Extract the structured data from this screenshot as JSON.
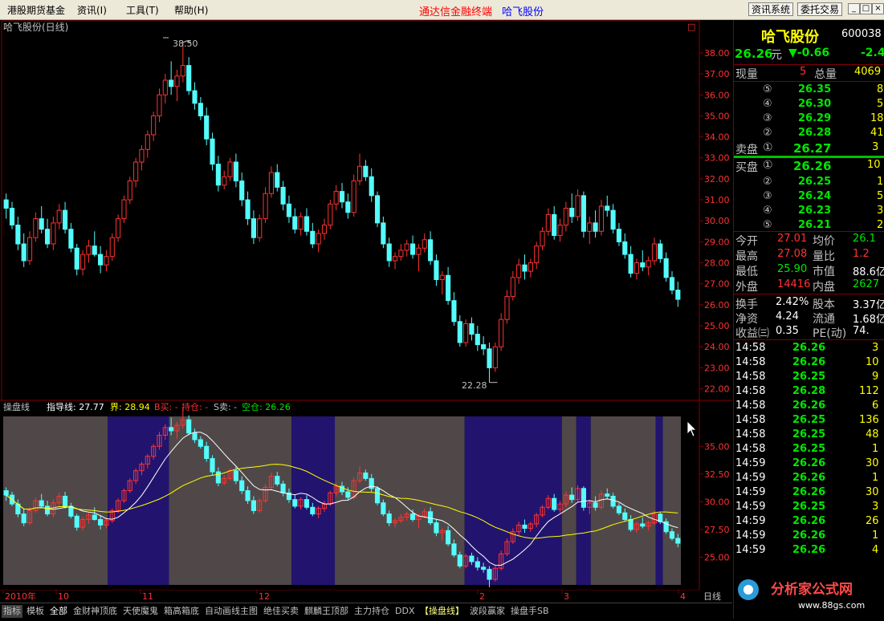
{
  "menu": {
    "items": [
      "港股期货基金",
      "资讯(I)",
      "工具(T)",
      "帮助(H)"
    ],
    "center_title": "通达信金融终端",
    "center_stock": "哈飞股份",
    "btn_news": "资讯系统",
    "btn_trade": "委托交易",
    "win_min": "_",
    "win_max": "□",
    "win_close": "×"
  },
  "colors": {
    "up": "#ff3232",
    "down": "#54fcfc",
    "green": "#00e600",
    "yellow": "#ffff00",
    "white": "#ffffff",
    "gray": "#c0c0c0"
  },
  "main_chart": {
    "title": "哈飞股份(日线)",
    "max_label": "38.50",
    "min_label": "22.28",
    "corner_box": "□"
  },
  "indicator_chart": {
    "name": "操盘线",
    "line_label": "指导线: 27.77",
    "bound_label": "界: 28.94",
    "b_buy": "B买: -",
    "hold": "持仓: -",
    "s_sell": "S卖: -",
    "empty": "空仓: 26.26"
  },
  "chart_data": {
    "type": "candlestick",
    "y_ticks": [
      "38.00",
      "37.00",
      "36.00",
      "35.00",
      "34.00",
      "33.00",
      "32.00",
      "31.00",
      "30.00",
      "29.00",
      "28.00",
      "27.00",
      "26.00",
      "25.00",
      "24.00",
      "23.00",
      "22.00"
    ],
    "y_range": [
      21.6,
      38.8
    ],
    "indicator_y_ticks": [
      "35.00",
      "32.50",
      "30.00",
      "27.50",
      "25.00"
    ],
    "indicator_y_range": [
      22.5,
      37.7
    ],
    "x_labels": [
      "2010年",
      "10",
      "11",
      "12",
      "2",
      "3",
      "4"
    ],
    "candles": [
      [
        31.0,
        31.3,
        30.1,
        30.6
      ],
      [
        30.6,
        30.9,
        29.6,
        29.8
      ],
      [
        29.8,
        30.2,
        28.6,
        28.9
      ],
      [
        28.9,
        29.4,
        27.8,
        28.1
      ],
      [
        28.1,
        29.5,
        27.9,
        29.2
      ],
      [
        29.2,
        30.4,
        29.0,
        30.1
      ],
      [
        30.1,
        30.7,
        29.4,
        29.6
      ],
      [
        29.6,
        30.1,
        28.7,
        28.9
      ],
      [
        28.9,
        30.2,
        28.6,
        29.9
      ],
      [
        29.9,
        30.8,
        29.6,
        30.5
      ],
      [
        30.5,
        30.9,
        29.4,
        29.6
      ],
      [
        29.6,
        29.9,
        28.5,
        28.7
      ],
      [
        28.7,
        28.9,
        27.4,
        27.7
      ],
      [
        27.7,
        28.6,
        27.4,
        28.4
      ],
      [
        28.4,
        29.1,
        28.0,
        28.8
      ],
      [
        28.8,
        29.5,
        28.3,
        28.4
      ],
      [
        28.4,
        28.8,
        27.5,
        27.9
      ],
      [
        27.9,
        28.6,
        27.6,
        28.3
      ],
      [
        28.3,
        29.4,
        28.1,
        29.2
      ],
      [
        29.2,
        30.3,
        29.0,
        30.1
      ],
      [
        30.1,
        31.2,
        29.9,
        31.0
      ],
      [
        31.0,
        32.1,
        30.8,
        31.9
      ],
      [
        31.9,
        33.0,
        31.6,
        32.8
      ],
      [
        32.8,
        33.6,
        32.4,
        33.4
      ],
      [
        33.4,
        34.3,
        33.0,
        34.1
      ],
      [
        34.1,
        35.2,
        33.8,
        35.0
      ],
      [
        35.0,
        36.3,
        34.7,
        36.0
      ],
      [
        36.0,
        37.0,
        35.6,
        36.7
      ],
      [
        36.7,
        37.6,
        36.0,
        36.4
      ],
      [
        36.4,
        37.2,
        35.7,
        36.9
      ],
      [
        36.9,
        38.5,
        36.6,
        37.4
      ],
      [
        37.4,
        37.8,
        36.0,
        36.2
      ],
      [
        36.2,
        36.6,
        35.3,
        35.6
      ],
      [
        35.6,
        35.9,
        34.8,
        35.0
      ],
      [
        35.0,
        35.4,
        33.6,
        33.9
      ],
      [
        33.9,
        34.2,
        32.4,
        32.7
      ],
      [
        32.7,
        33.1,
        31.4,
        31.7
      ],
      [
        31.7,
        32.4,
        31.5,
        32.1
      ],
      [
        32.1,
        33.0,
        31.9,
        32.8
      ],
      [
        32.8,
        33.2,
        31.6,
        31.9
      ],
      [
        31.9,
        32.3,
        30.7,
        31.0
      ],
      [
        31.0,
        31.4,
        29.8,
        30.1
      ],
      [
        30.1,
        30.5,
        28.9,
        29.2
      ],
      [
        29.2,
        30.3,
        29.0,
        30.1
      ],
      [
        30.1,
        31.6,
        29.9,
        31.3
      ],
      [
        31.3,
        32.6,
        31.1,
        32.3
      ],
      [
        32.3,
        32.7,
        31.4,
        31.6
      ],
      [
        31.6,
        31.9,
        30.5,
        30.8
      ],
      [
        30.8,
        31.2,
        29.9,
        30.2
      ],
      [
        30.2,
        30.6,
        29.4,
        29.6
      ],
      [
        29.6,
        30.4,
        29.3,
        30.2
      ],
      [
        30.2,
        30.6,
        29.3,
        29.5
      ],
      [
        29.5,
        29.9,
        28.7,
        28.9
      ],
      [
        28.9,
        29.6,
        28.5,
        29.4
      ],
      [
        29.4,
        30.1,
        29.1,
        29.8
      ],
      [
        29.8,
        31.0,
        29.6,
        30.8
      ],
      [
        30.8,
        31.7,
        30.5,
        31.4
      ],
      [
        31.4,
        31.8,
        30.6,
        30.9
      ],
      [
        30.9,
        31.3,
        30.1,
        30.4
      ],
      [
        30.4,
        32.2,
        30.2,
        31.9
      ],
      [
        31.9,
        33.2,
        31.7,
        32.6
      ],
      [
        32.6,
        32.9,
        31.9,
        32.1
      ],
      [
        32.1,
        32.5,
        30.9,
        31.2
      ],
      [
        31.2,
        31.4,
        29.7,
        29.9
      ],
      [
        29.9,
        30.2,
        28.7,
        28.9
      ],
      [
        28.9,
        29.2,
        27.8,
        28.1
      ],
      [
        28.1,
        28.5,
        27.7,
        28.3
      ],
      [
        28.3,
        28.9,
        28.1,
        28.6
      ],
      [
        28.6,
        29.1,
        28.3,
        28.9
      ],
      [
        28.9,
        29.3,
        28.2,
        28.4
      ],
      [
        28.4,
        28.9,
        27.6,
        28.7
      ],
      [
        28.7,
        29.4,
        28.5,
        29.1
      ],
      [
        29.1,
        29.5,
        27.9,
        28.1
      ],
      [
        28.1,
        28.4,
        26.9,
        27.2
      ],
      [
        27.2,
        27.6,
        26.5,
        27.4
      ],
      [
        27.4,
        27.8,
        26.0,
        26.2
      ],
      [
        26.2,
        26.6,
        25.0,
        25.2
      ],
      [
        25.2,
        25.5,
        24.0,
        24.2
      ],
      [
        24.2,
        25.3,
        24.0,
        25.1
      ],
      [
        25.1,
        25.4,
        24.3,
        24.6
      ],
      [
        24.6,
        25.0,
        23.8,
        24.1
      ],
      [
        24.1,
        24.5,
        23.6,
        23.9
      ],
      [
        23.9,
        24.2,
        22.3,
        23.0
      ],
      [
        23.0,
        24.2,
        22.8,
        24.0
      ],
      [
        24.0,
        25.6,
        23.8,
        25.3
      ],
      [
        25.3,
        26.7,
        25.1,
        26.4
      ],
      [
        26.4,
        27.6,
        26.2,
        27.3
      ],
      [
        27.3,
        28.2,
        27.0,
        27.9
      ],
      [
        27.9,
        28.4,
        27.2,
        27.6
      ],
      [
        27.6,
        28.2,
        27.3,
        28.0
      ],
      [
        28.0,
        29.0,
        27.7,
        28.8
      ],
      [
        28.8,
        29.7,
        28.6,
        29.5
      ],
      [
        29.5,
        30.6,
        29.3,
        30.3
      ],
      [
        30.3,
        30.7,
        29.1,
        29.3
      ],
      [
        29.3,
        30.1,
        29.0,
        29.8
      ],
      [
        29.8,
        30.9,
        29.5,
        30.6
      ],
      [
        30.6,
        31.3,
        29.9,
        30.2
      ],
      [
        30.2,
        31.5,
        30.0,
        31.2
      ],
      [
        31.2,
        31.4,
        29.2,
        29.5
      ],
      [
        29.5,
        30.2,
        28.9,
        29.9
      ],
      [
        29.9,
        30.5,
        29.2,
        29.5
      ],
      [
        29.5,
        31.0,
        29.3,
        30.7
      ],
      [
        30.7,
        31.2,
        30.2,
        30.5
      ],
      [
        30.5,
        30.8,
        29.4,
        29.6
      ],
      [
        29.6,
        29.9,
        28.8,
        29.0
      ],
      [
        29.0,
        29.4,
        28.2,
        28.4
      ],
      [
        28.4,
        28.8,
        27.3,
        27.5
      ],
      [
        27.5,
        28.2,
        27.2,
        28.0
      ],
      [
        28.0,
        28.6,
        27.6,
        27.8
      ],
      [
        27.8,
        28.3,
        27.4,
        28.1
      ],
      [
        28.1,
        29.2,
        27.9,
        28.9
      ],
      [
        28.9,
        29.1,
        28.0,
        28.2
      ],
      [
        28.2,
        28.5,
        27.1,
        27.3
      ],
      [
        27.3,
        27.6,
        26.5,
        26.7
      ],
      [
        26.7,
        27.1,
        25.9,
        26.26
      ]
    ],
    "indicator_bands": [
      {
        "from": 0,
        "to": 29,
        "color": "#504848"
      },
      {
        "from": 29,
        "to": 46,
        "color": "#22146e"
      },
      {
        "from": 46,
        "to": 80,
        "color": "#504848"
      },
      {
        "from": 80,
        "to": 92,
        "color": "#22146e"
      },
      {
        "from": 92,
        "to": 128,
        "color": "#504848"
      },
      {
        "from": 128,
        "to": 155,
        "color": "#22146e"
      },
      {
        "from": 155,
        "to": 159,
        "color": "#504848"
      },
      {
        "from": 159,
        "to": 163,
        "color": "#22146e"
      },
      {
        "from": 163,
        "to": 181,
        "color": "#504848"
      },
      {
        "from": 181,
        "to": 183,
        "color": "#22146e"
      },
      {
        "from": 183,
        "to": 188,
        "color": "#504848"
      }
    ]
  },
  "panel": {
    "stock_name": "哈飞股份",
    "stock_code": "600038",
    "price": "26.26",
    "price_unit": "元",
    "change": "▼-0.66",
    "change_pct": "-2.4",
    "now_vol_label": "现量",
    "now_vol": "5",
    "total_vol_label": "总量",
    "total_vol": "4069",
    "asks": [
      {
        "idx": "⑤",
        "price": "26.35",
        "vol": "8"
      },
      {
        "idx": "④",
        "price": "26.30",
        "vol": "5"
      },
      {
        "idx": "③",
        "price": "26.29",
        "vol": "18"
      },
      {
        "idx": "②",
        "price": "26.28",
        "vol": "41"
      }
    ],
    "ask1_label": "卖盘",
    "ask1_idx": "①",
    "ask1_price": "26.27",
    "ask1_vol": "3",
    "bid1_label": "买盘",
    "bid1_idx": "①",
    "bid1_price": "26.26",
    "bid1_vol": "10",
    "bids": [
      {
        "idx": "②",
        "price": "26.25",
        "vol": "1"
      },
      {
        "idx": "③",
        "price": "26.24",
        "vol": "5"
      },
      {
        "idx": "④",
        "price": "26.23",
        "vol": "3"
      },
      {
        "idx": "⑤",
        "price": "26.21",
        "vol": "2"
      }
    ],
    "stats": [
      {
        "l1": "今开",
        "v1": "27.01",
        "c1": "up",
        "l2": "均价",
        "v2": "26.1",
        "c2": "down"
      },
      {
        "l1": "最高",
        "v1": "27.08",
        "c1": "up",
        "l2": "量比",
        "v2": "1.2",
        "c2": "up"
      },
      {
        "l1": "最低",
        "v1": "25.90",
        "c1": "down",
        "l2": "市值",
        "v2": "88.6亿",
        "c2": "white"
      },
      {
        "l1": "外盘",
        "v1": "14416",
        "c1": "up",
        "l2": "内盘",
        "v2": "2627",
        "c2": "down"
      }
    ],
    "stats2": [
      {
        "l1": "换手",
        "v1": "2.42%",
        "l2": "股本",
        "v2": "3.37亿"
      },
      {
        "l1": "净资",
        "v1": "4.24",
        "l2": "流通",
        "v2": "1.68亿"
      },
      {
        "l1": "收益㈢",
        "v1": "0.35",
        "l2": "PE(动)",
        "v2": "74."
      }
    ],
    "ticks": [
      {
        "time": "14:58",
        "price": "26.26",
        "vol": "3",
        "c": "up"
      },
      {
        "time": "14:58",
        "price": "26.26",
        "vol": "10",
        "c": "up"
      },
      {
        "time": "14:58",
        "price": "26.25",
        "vol": "9",
        "c": "up"
      },
      {
        "time": "14:58",
        "price": "26.28",
        "vol": "112",
        "c": "up"
      },
      {
        "time": "14:58",
        "price": "26.26",
        "vol": "6",
        "c": "up"
      },
      {
        "time": "14:58",
        "price": "26.25",
        "vol": "136",
        "c": "down"
      },
      {
        "time": "14:58",
        "price": "26.25",
        "vol": "48",
        "c": "down"
      },
      {
        "time": "14:58",
        "price": "26.25",
        "vol": "1",
        "c": "up"
      },
      {
        "time": "14:59",
        "price": "26.26",
        "vol": "30",
        "c": "up"
      },
      {
        "time": "14:59",
        "price": "26.26",
        "vol": "1",
        "c": "up"
      },
      {
        "time": "14:59",
        "price": "26.26",
        "vol": "30",
        "c": "up"
      },
      {
        "time": "14:59",
        "price": "26.25",
        "vol": "3",
        "c": "down"
      },
      {
        "time": "14:59",
        "price": "26.26",
        "vol": "26",
        "c": "up"
      },
      {
        "time": "14:59",
        "price": "26.26",
        "vol": "1",
        "c": "up"
      },
      {
        "time": "14:59",
        "price": "26.26",
        "vol": "4",
        "c": "up"
      }
    ],
    "logo_text": "分析家公式网",
    "logo_url": "www.88gs.com"
  },
  "bottom_tabs": [
    "指标",
    "模板",
    "全部",
    "金财神顶底",
    "天使魔鬼",
    "箱高箱底",
    "自动画线主图",
    "绝佳买卖",
    "麒麟王顶部",
    "主力持仓",
    "DDX",
    "【操盘线】",
    "波段赢家",
    "操盘手SB"
  ],
  "timeaxis_right": "日线"
}
